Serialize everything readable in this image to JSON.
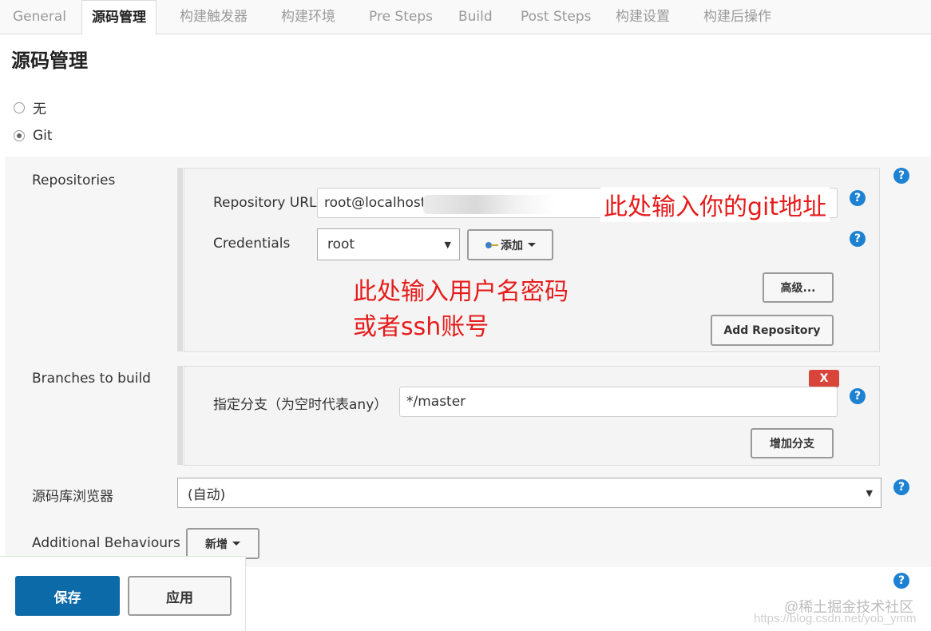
{
  "tabs": [
    {
      "label": "General"
    },
    {
      "label": "源码管理"
    },
    {
      "label": "构建触发器"
    },
    {
      "label": "构建环境"
    },
    {
      "label": "Pre Steps"
    },
    {
      "label": "Build"
    },
    {
      "label": "Post Steps"
    },
    {
      "label": "构建设置"
    },
    {
      "label": "构建后操作"
    }
  ],
  "section_title": "源码管理",
  "scm_options": [
    {
      "label": "无",
      "checked": false
    },
    {
      "label": "Git",
      "checked": true
    }
  ],
  "repositories": {
    "label": "Repositories",
    "url_label": "Repository URL",
    "url_value": "root@localhost:/",
    "credentials_label": "Credentials",
    "credentials_value": "root",
    "add_button": "添加",
    "advanced_button": "高级...",
    "add_repository_button": "Add Repository"
  },
  "branches": {
    "label": "Branches to build",
    "branch_label": "指定分支（为空时代表any）",
    "branch_value": "*/master",
    "delete_button": "X",
    "add_branch_button": "增加分支"
  },
  "browser": {
    "label": "源码库浏览器",
    "value": "(自动)"
  },
  "behaviours": {
    "label": "Additional Behaviours",
    "add_button": "新增"
  },
  "actions": {
    "save": "保存",
    "apply": "应用"
  },
  "annotations": {
    "url_note": "此处输入你的git地址",
    "credentials_note_line1": "此处输入用户名密码",
    "credentials_note_line2": "或者ssh账号"
  },
  "help_label": "?",
  "watermark": {
    "line1": "@稀土掘金技术社区",
    "line2": "https://blog.csdn.net/yob_ymm"
  },
  "colors": {
    "help_blue": "#1e82d3",
    "save_blue": "#0d6aa8",
    "delete_red": "#d9453b",
    "annotation_red": "#e61b1b"
  }
}
